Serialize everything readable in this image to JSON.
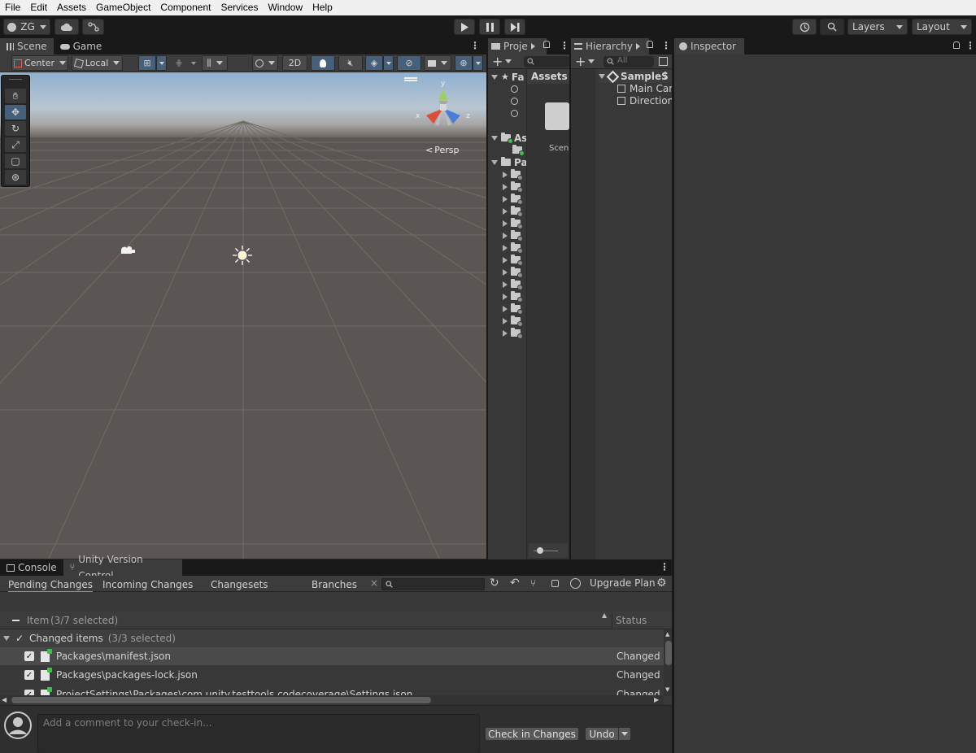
{
  "menu": [
    "File",
    "Edit",
    "Assets",
    "GameObject",
    "Component",
    "Services",
    "Window",
    "Help"
  ],
  "toolbar": {
    "account": "ZG",
    "layers": "Layers",
    "layout": "Layout"
  },
  "scene_panel": {
    "tabs": [
      "Scene",
      "Game"
    ],
    "pivot_mode": "Center",
    "pivot_rotation": "Local",
    "mode_2d": "2D",
    "persp_label": "Persp",
    "gizmo_axes": {
      "y": "y",
      "x": "x",
      "z": "z"
    }
  },
  "project_panel": {
    "tab": "Proje",
    "breadcrumb": "Assets",
    "favorites": "Fa",
    "assets": "As",
    "packages": "Pa",
    "scene_thumb_label": "Scen"
  },
  "hierarchy_panel": {
    "tab": "Hierarchy",
    "search_placeholder": "All",
    "scene_name": "SampleS",
    "items": [
      "Main Cam",
      "Directiona"
    ]
  },
  "inspector_panel": {
    "tab": "Inspector"
  },
  "bottom_panel": {
    "tabs": [
      "Console",
      "Unity Version Control"
    ],
    "vc_tabs": [
      "Pending Changes",
      "Incoming Changes",
      "Changesets",
      "Branches"
    ],
    "upgrade_plan": "Upgrade Plan",
    "column_item": "Item",
    "column_item_count": "(3/7 selected)",
    "column_status": "Status",
    "group_label": "Changed items",
    "group_count": "(3/3 selected)",
    "files": [
      {
        "path": "Packages\\manifest.json",
        "status": "Changed"
      },
      {
        "path": "Packages\\packages-lock.json",
        "status": "Changed"
      },
      {
        "path": "ProjectSettings\\Packages\\com.unity.testtools.codecoverage\\Settings.json",
        "status": "Changed"
      }
    ],
    "comment_placeholder": "Add a comment to your check-in...",
    "checkin_button": "Check in Changes",
    "undo_button": "Undo"
  }
}
